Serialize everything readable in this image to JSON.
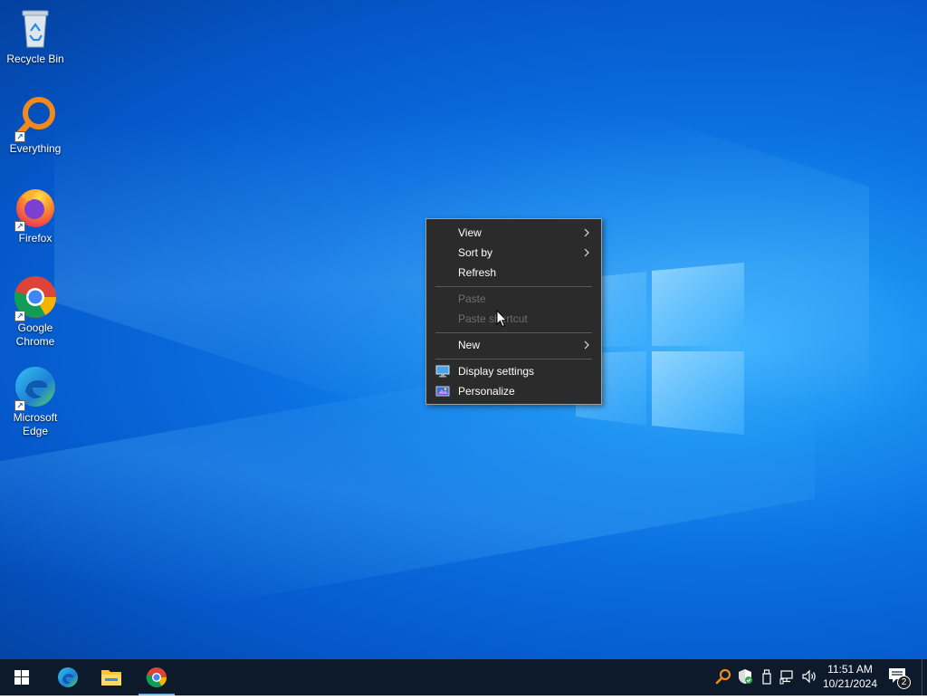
{
  "desktop": {
    "icons": [
      {
        "label": "Recycle Bin",
        "icon": "recycle-bin-icon"
      },
      {
        "label": "Everything",
        "icon": "everything-search-icon"
      },
      {
        "label": "Firefox",
        "icon": "firefox-icon"
      },
      {
        "label": "Google Chrome",
        "icon": "chrome-icon"
      },
      {
        "label": "Microsoft Edge",
        "icon": "edge-icon"
      }
    ]
  },
  "context_menu": {
    "items": [
      {
        "label": "View",
        "enabled": true,
        "submenu": true
      },
      {
        "label": "Sort by",
        "enabled": true,
        "submenu": true
      },
      {
        "label": "Refresh",
        "enabled": true,
        "submenu": false
      },
      {
        "label": "Paste",
        "enabled": false,
        "submenu": false
      },
      {
        "label": "Paste shortcut",
        "enabled": false,
        "submenu": false
      },
      {
        "label": "New",
        "enabled": true,
        "submenu": true
      },
      {
        "label": "Display settings",
        "enabled": true,
        "submenu": false,
        "icon": "display-icon"
      },
      {
        "label": "Personalize",
        "enabled": true,
        "submenu": false,
        "icon": "personalize-icon"
      }
    ]
  },
  "taskbar": {
    "pinned": [
      {
        "name": "start",
        "icon": "windows-start-icon"
      },
      {
        "name": "edge",
        "icon": "edge-icon"
      },
      {
        "name": "file-explorer",
        "icon": "folder-icon"
      },
      {
        "name": "chrome",
        "icon": "chrome-icon",
        "active": true
      }
    ],
    "tray": {
      "icons": [
        "everything-search-icon",
        "security-shield-icon",
        "usb-device-icon",
        "network-icon",
        "volume-icon"
      ]
    },
    "clock": {
      "time": "11:51 AM",
      "date": "10/21/2024"
    },
    "notifications": {
      "count": "2"
    }
  },
  "colors": {
    "taskbar": "#0c1a2c",
    "menu_bg": "#2b2b2b",
    "menu_disabled_text": "#6d6d6d",
    "accent": "#76b9ed"
  }
}
